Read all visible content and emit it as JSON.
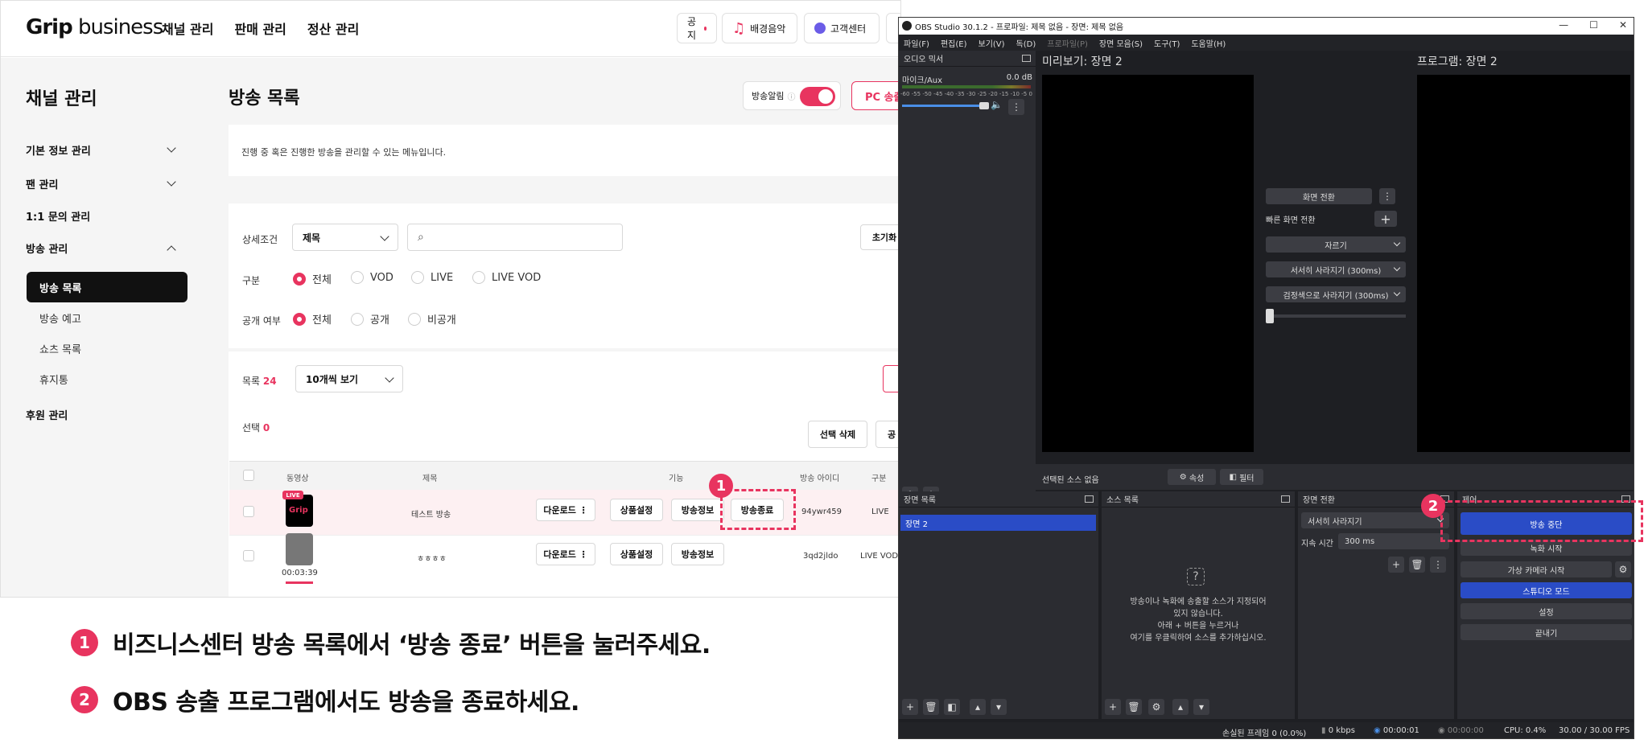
{
  "grip": {
    "logo_bold": "Grip",
    "logo_rest": " business",
    "nav": [
      "채널 관리",
      "판매 관리",
      "정산 관리"
    ],
    "top_buttons": {
      "notice": "공지",
      "music": "배경음악",
      "support": "고객센터"
    },
    "sidebar": {
      "title": "채널 관리",
      "items": [
        "기본 정보 관리",
        "팬 관리",
        "1:1 문의 관리",
        "방송 관리",
        "후원 관리"
      ],
      "sub_items": [
        "방송 목록",
        "방송 예고",
        "쇼츠 목록",
        "휴지통"
      ]
    },
    "page_title": "방송 목록",
    "alarm_label": "방송알림",
    "pc_button": "PC 송출",
    "description": "진행 중 혹은 진행한 방송을 관리할 수 있는 메뉴입니다.",
    "filter": {
      "detail_label": "상세조건",
      "detail_value": "제목",
      "reset": "초기화",
      "type_label": "구분",
      "type_options": [
        "전체",
        "VOD",
        "LIVE",
        "LIVE VOD"
      ],
      "public_label": "공개 여부",
      "public_options": [
        "전체",
        "공개",
        "비공개"
      ]
    },
    "list": {
      "count_label": "목록",
      "count": "24",
      "per_page": "10개씩 보기",
      "selected_label": "선택",
      "selected": "0",
      "delete_selected": "선택 삭제",
      "public_btn": "공"
    },
    "table": {
      "headers": [
        "동영상",
        "제목",
        "기능",
        "방송 아이디",
        "구분"
      ],
      "rows": [
        {
          "title": "테스트 방송",
          "actions": [
            "다운로드",
            "상품설정",
            "방송정보",
            "방송종료"
          ],
          "id": "94ywr459",
          "type": "LIVE",
          "badge": "LIVE",
          "thumb": "Grip"
        },
        {
          "title": "ㅎㅎㅎㅎ",
          "actions": [
            "다운로드",
            "상품설정",
            "방송정보"
          ],
          "id": "3qd2jldo",
          "type": "LIVE VOD",
          "duration": "00:03:39"
        }
      ]
    }
  },
  "obs": {
    "title": "OBS Studio 30.1.2 - 프로파일: 제목 없음 - 장면: 제목 없음",
    "menu": [
      "파일(F)",
      "편집(E)",
      "보기(V)",
      "독(D)",
      "프로파일(P)",
      "장면 모음(S)",
      "도구(T)",
      "도움말(H)"
    ],
    "audio_mixer": "오디오 믹서",
    "mic_label": "마이크/Aux",
    "mic_db": "0.0 dB",
    "meter_scale": "-60 -55 -50 -45 -40 -35 -30 -25 -20 -15 -10 -5 0",
    "preview": "미리보기: 장면 2",
    "program": "프로그램: 장면 2",
    "transition_btn": "화면 전환",
    "quick_transition": "빠른 화면 전환",
    "cut": "자르기",
    "fade": "서서히 사라지기 (300ms)",
    "fade_black": "검정색으로 사라지기 (300ms)",
    "no_source": "선택된 소스 없음",
    "properties": "속성",
    "filters": "필터",
    "scenes_title": "장면 목록",
    "scene_item": "장면 2",
    "sources_title": "소스 목록",
    "sources_empty": [
      "방송이나 녹화에 송출할 소스가 지정되어",
      "있지 않습니다.",
      "아래 + 버튼을 누르거나",
      "여기를 우클릭하여 소스를 추가하십시오."
    ],
    "transitions_title": "장면 전환",
    "transition_select": "서서히 사라지기",
    "duration_label": "지속 시간",
    "duration_value": "300 ms",
    "controls_title": "제어",
    "controls": [
      "방송 중단",
      "녹화 시작",
      "가상 카메라 시작",
      "스튜디오 모드",
      "설정",
      "끝내기"
    ],
    "status": {
      "dropped": "손실된 프레임 0 (0.0%)",
      "kbps": "0 kbps",
      "stream_time": "00:00:01",
      "rec_time": "00:00:00",
      "cpu": "CPU: 0.4%",
      "fps": "30.00 / 30.00 FPS"
    }
  },
  "steps": [
    {
      "num": "1",
      "text": "비즈니스센터 방송 목록에서 ‘방송 종료’ 버튼을 눌러주세요."
    },
    {
      "num": "2",
      "text": "OBS 송출 프로그램에서도 방송을 종료하세요."
    }
  ],
  "colors": {
    "accent": "#e8345f",
    "obs_blue": "#2a4cc6"
  }
}
